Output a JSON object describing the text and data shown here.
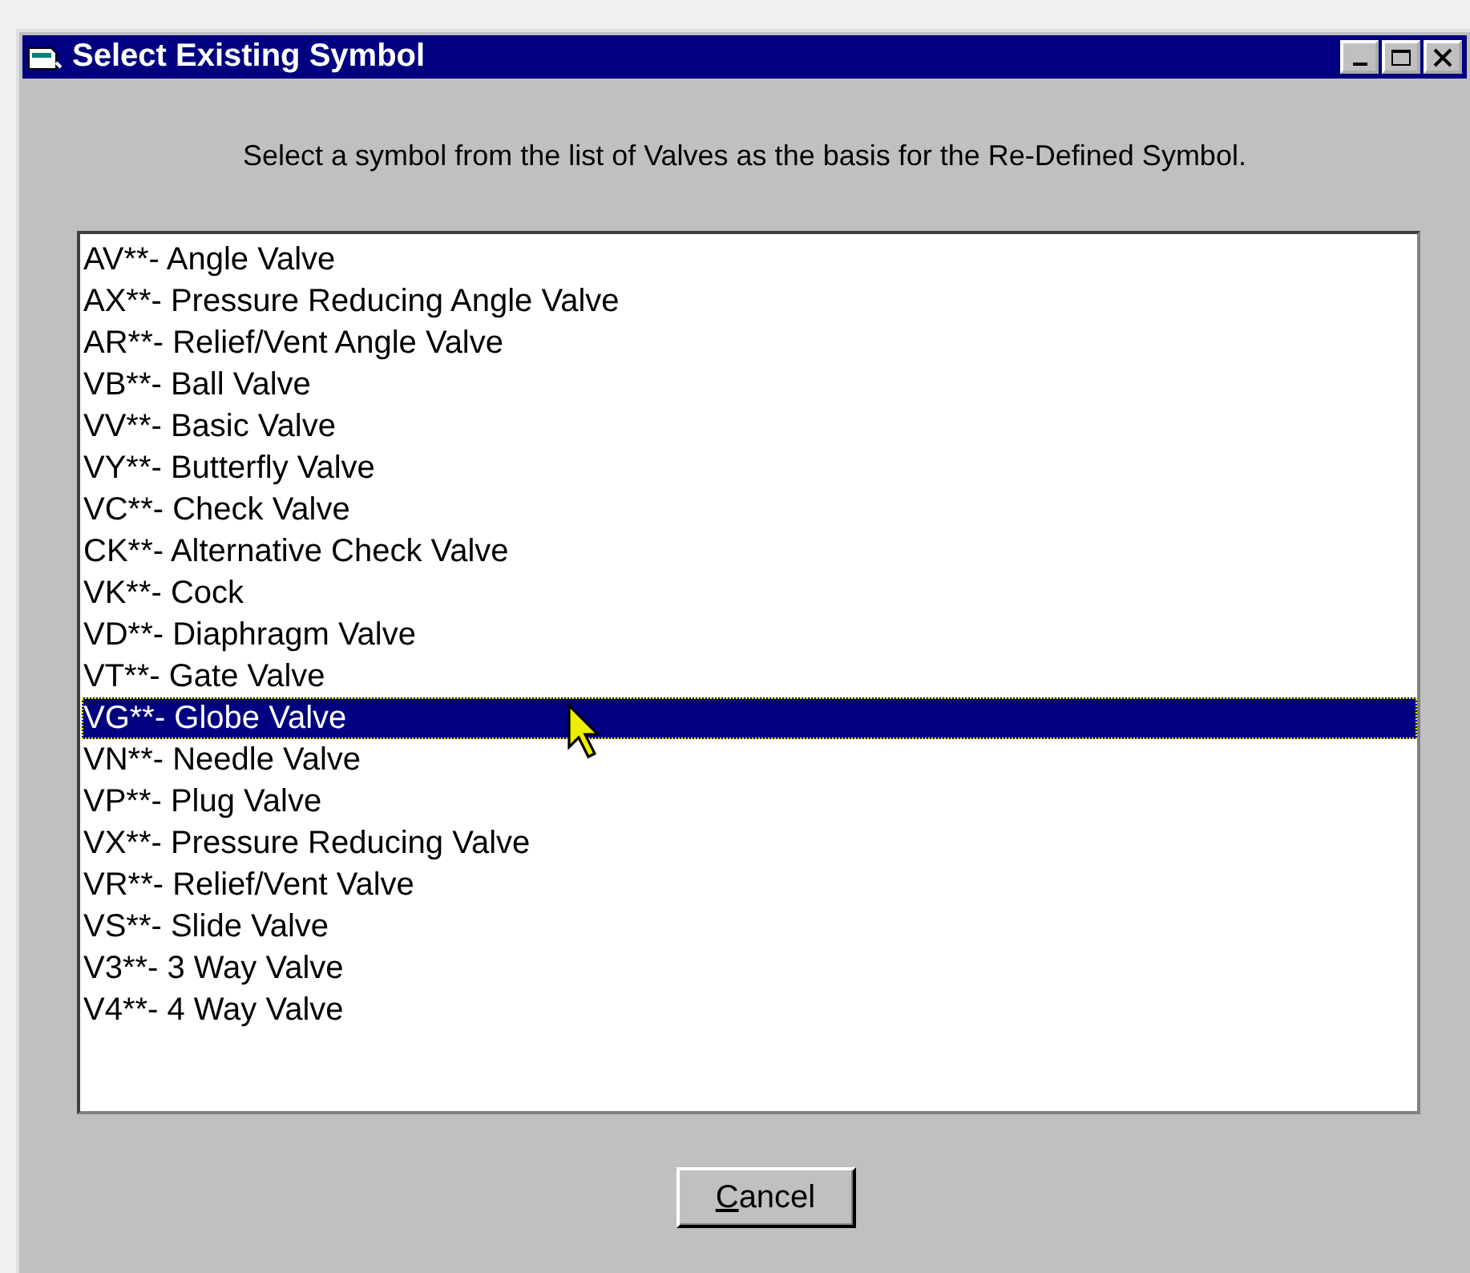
{
  "window": {
    "title": "Select Existing Symbol"
  },
  "instruction": "Select a symbol from the list of Valves as the basis for the Re-Defined Symbol.",
  "symbols": [
    {
      "label": "AV**- Angle Valve",
      "selected": false
    },
    {
      "label": "AX**- Pressure Reducing Angle Valve",
      "selected": false
    },
    {
      "label": "AR**- Relief/Vent Angle Valve",
      "selected": false
    },
    {
      "label": "VB**- Ball Valve",
      "selected": false
    },
    {
      "label": "VV**- Basic Valve",
      "selected": false
    },
    {
      "label": "VY**- Butterfly Valve",
      "selected": false
    },
    {
      "label": "VC**- Check Valve",
      "selected": false
    },
    {
      "label": "CK**- Alternative Check Valve",
      "selected": false
    },
    {
      "label": "VK**- Cock",
      "selected": false
    },
    {
      "label": "VD**- Diaphragm Valve",
      "selected": false
    },
    {
      "label": "VT**- Gate Valve",
      "selected": false
    },
    {
      "label": "VG**- Globe Valve",
      "selected": true
    },
    {
      "label": "VN**- Needle Valve",
      "selected": false
    },
    {
      "label": "VP**- Plug Valve",
      "selected": false
    },
    {
      "label": "VX**- Pressure Reducing Valve",
      "selected": false
    },
    {
      "label": "VR**- Relief/Vent Valve",
      "selected": false
    },
    {
      "label": "VS**- Slide Valve",
      "selected": false
    },
    {
      "label": "V3**- 3 Way Valve",
      "selected": false
    },
    {
      "label": "V4**- 4 Way Valve",
      "selected": false
    }
  ],
  "buttons": [
    {
      "label": "Cancel"
    }
  ]
}
